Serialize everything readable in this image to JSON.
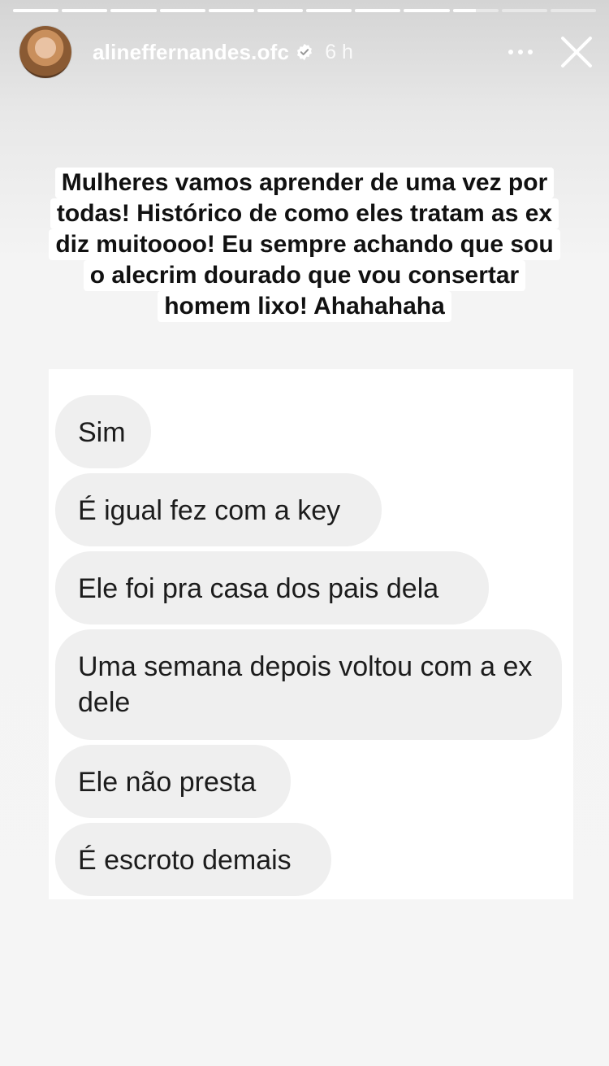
{
  "story": {
    "progress": [
      1,
      1,
      1,
      1,
      1,
      1,
      1,
      1,
      1,
      0.5,
      0,
      0
    ],
    "username": "alineffernandes.ofc",
    "time": "6 h"
  },
  "caption": {
    "lines": [
      "Mulheres vamos aprender de uma vez por",
      "todas! Histórico de como eles tratam as ex",
      "diz muitoooo! Eu sempre achando que sou",
      "o alecrim dourado que vou consertar",
      "homem lixo! Ahahahaha"
    ]
  },
  "messages": [
    "Sim",
    "É igual fez com a key",
    "Ele foi pra casa dos pais dela",
    "Uma semana depois voltou com a ex dele",
    "Ele não presta",
    "É escroto demais"
  ],
  "colors": {
    "verified": "#ffffff",
    "bubble": "#efefef"
  }
}
